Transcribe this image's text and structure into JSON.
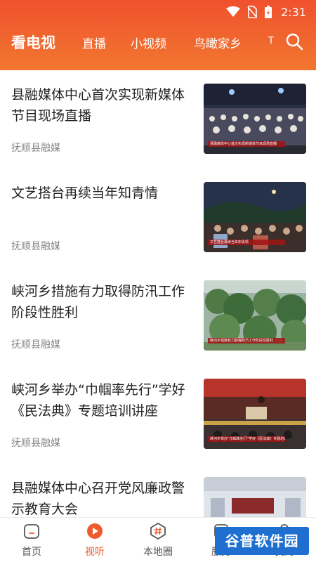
{
  "status_bar": {
    "time": "2:31",
    "icons": [
      "wifi-icon",
      "no-sim-icon",
      "battery-charging-icon"
    ]
  },
  "tabs": [
    {
      "label": "看电视",
      "active": true
    },
    {
      "label": "直播",
      "active": false
    },
    {
      "label": "小视频",
      "active": false
    },
    {
      "label": "鸟瞰家乡",
      "active": false
    },
    {
      "label": "Т",
      "active": false
    }
  ],
  "search_icon": "search-icon",
  "articles": [
    {
      "title": "县融媒体中心首次实现新媒体节目现场直播",
      "source": "抚顺县融媒",
      "thumb_caption": "县融媒体中心首次实现新媒体节目现场直播"
    },
    {
      "title": "文艺搭台再续当年知青情",
      "source": "抚顺县融媒",
      "thumb_caption": "文艺搭台再续当年知青情"
    },
    {
      "title": "峡河乡措施有力取得防汛工作阶段性胜利",
      "source": "抚顺县融媒",
      "thumb_caption": "峡河乡措施有力取得防汛工作阶段性胜利"
    },
    {
      "title": "峡河乡举办“巾帼率先行”学好《民法典》专题培训讲座",
      "source": "抚顺县融媒",
      "thumb_caption": "峡河乡举办“巾帼率先行”学好《民法典》专题培训讲座"
    },
    {
      "title": "县融媒体中心召开党风廉政警示教育大会",
      "source": "",
      "thumb_caption": ""
    }
  ],
  "bottom_nav": [
    {
      "label": "首页",
      "icon": "home-icon",
      "active": false
    },
    {
      "label": "视听",
      "icon": "play-icon",
      "active": true
    },
    {
      "label": "本地圈",
      "icon": "hashtag-icon",
      "active": false
    },
    {
      "label": "服务",
      "icon": "service-icon",
      "active": false
    },
    {
      "label": "我的",
      "icon": "profile-icon",
      "active": false
    }
  ],
  "watermark": "谷普软件园",
  "colors": {
    "header_start": "#f0512e",
    "header_end": "#f1772f",
    "accent": "#ee5a2c",
    "title_text": "#222222",
    "source_text": "#888888"
  }
}
